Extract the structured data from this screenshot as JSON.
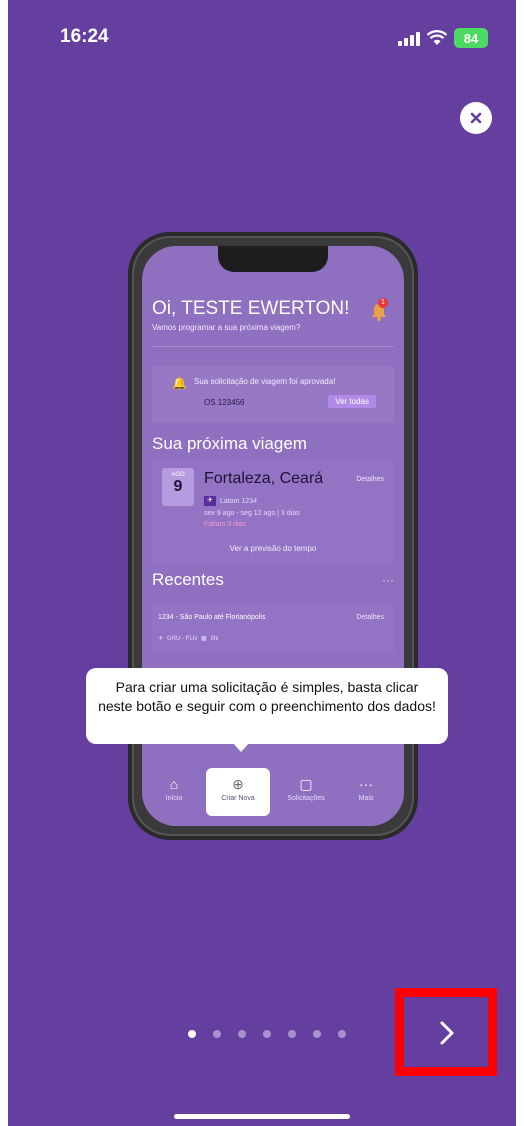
{
  "status_bar": {
    "time": "16:24",
    "battery": "84"
  },
  "mockup": {
    "greeting": "Oi, TESTE EWERTON!",
    "greeting_sub": "Vamos programar a sua próxima viagem?",
    "bell_badge": "1",
    "approval": {
      "text": "Sua solicitação de viagem foi aprovada!",
      "os": "OS 123456",
      "button": "Ver todas"
    },
    "next_trip": {
      "section_title": "Sua próxima viagem",
      "month": "AGO",
      "day": "9",
      "city": "Fortaleza, Ceará",
      "details": "Detalhes",
      "flight": "Latam 1234",
      "dates": "sex 9 ago - seg 12 ago | 3 dias",
      "remaining": "Faltam 0 dias",
      "weather_link": "Ver a previsão do tempo"
    },
    "recents": {
      "section_title": "Recentes",
      "more": "···",
      "item_title": "1234 - São Paulo até Florianópolis",
      "item_details": "Detalhes",
      "item_route": "GRU - FLN",
      "item_extra": "Ilhi"
    },
    "tabs": {
      "home": "Início",
      "new": "Criar Nova",
      "requests": "Solicitações",
      "more": "Mais"
    }
  },
  "tooltip": {
    "text": "Para criar uma solicitação é simples, basta clicar neste botão e seguir com o preenchimento dos dados!"
  },
  "pager": {
    "total": 7,
    "active_index": 0
  },
  "colors": {
    "background": "#653f9f",
    "highlight": "#ff0000",
    "battery": "#4cd964"
  }
}
